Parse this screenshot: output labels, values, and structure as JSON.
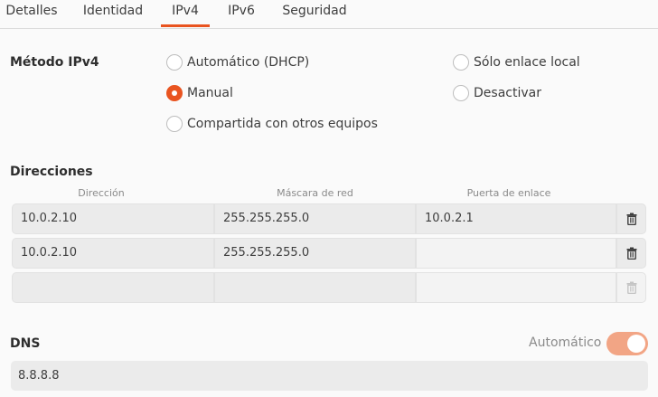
{
  "tabs": [
    {
      "label": "Detalles",
      "active": false
    },
    {
      "label": "Identidad",
      "active": false
    },
    {
      "label": "IPv4",
      "active": true
    },
    {
      "label": "IPv6",
      "active": false
    },
    {
      "label": "Seguridad",
      "active": false
    }
  ],
  "method": {
    "label": "Método IPv4",
    "options": [
      {
        "label": "Automático (DHCP)",
        "checked": false
      },
      {
        "label": "Manual",
        "checked": true
      },
      {
        "label": "Compartida con otros equipos",
        "checked": false
      },
      {
        "label": "Sólo enlace local",
        "checked": false
      },
      {
        "label": "Desactivar",
        "checked": false
      }
    ]
  },
  "addresses": {
    "label": "Direcciones",
    "columns": [
      "Dirección",
      "Máscara de red",
      "Puerta de enlace"
    ],
    "rows": [
      [
        "10.0.2.10",
        "255.255.255.0",
        "10.0.2.1"
      ],
      [
        "10.0.2.10",
        "255.255.255.0",
        ""
      ],
      [
        "",
        "",
        ""
      ]
    ]
  },
  "dns": {
    "label": "DNS",
    "auto_label": "Automático",
    "auto_enabled": true,
    "value": "8.8.8.8"
  },
  "colors": {
    "accent": "#e95420",
    "toggle_on": "#f2a585"
  },
  "icons": {
    "delete": "trash-icon"
  }
}
